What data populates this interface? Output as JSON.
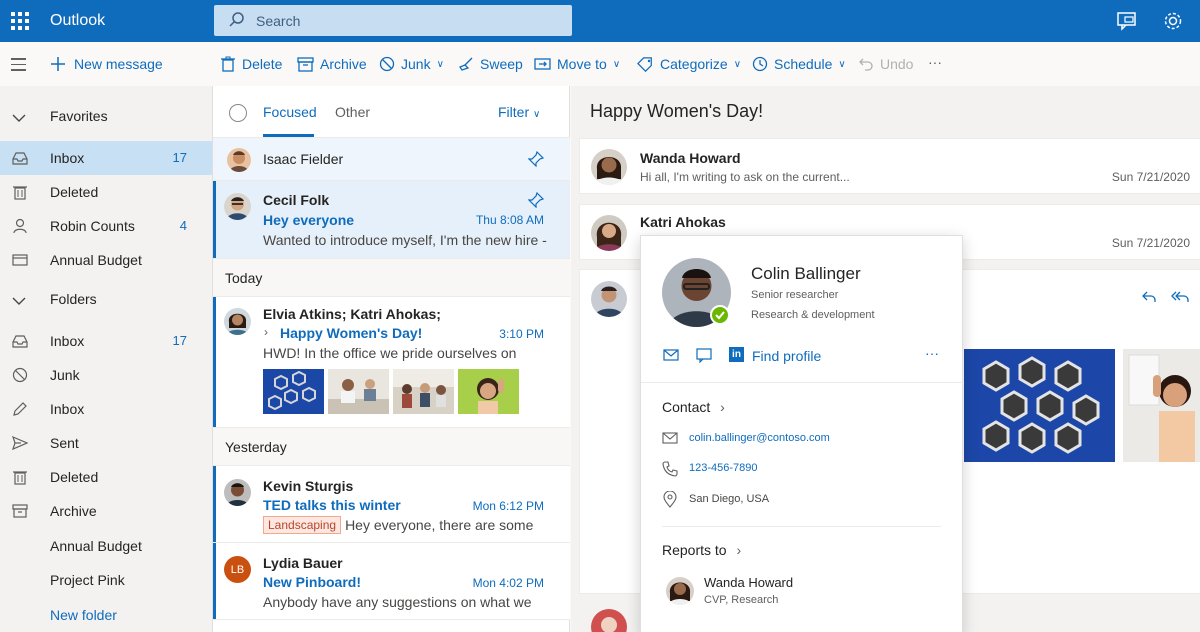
{
  "app": {
    "name": "Outlook"
  },
  "search": {
    "placeholder": "Search"
  },
  "toolbar": {
    "new_message": "New message",
    "delete": "Delete",
    "archive": "Archive",
    "junk": "Junk",
    "sweep": "Sweep",
    "move_to": "Move to",
    "categorize": "Categorize",
    "schedule": "Schedule",
    "undo": "Undo",
    "more": "···"
  },
  "nav": {
    "favorites": "Favorites",
    "folders_head": "Folders",
    "items": [
      {
        "label": "Inbox",
        "count": "17",
        "icon": "inbox-icon"
      },
      {
        "label": "Deleted",
        "count": "",
        "icon": "trash-icon"
      },
      {
        "label": "Robin Counts",
        "count": "4",
        "icon": "person-icon"
      },
      {
        "label": "Annual Budget",
        "count": "",
        "icon": "folder-icon"
      }
    ],
    "folders": [
      {
        "label": "Inbox",
        "count": "17",
        "icon": "inbox-icon"
      },
      {
        "label": "Junk",
        "count": "",
        "icon": "junk-icon"
      },
      {
        "label": "Inbox",
        "count": "",
        "icon": "pencil-icon"
      },
      {
        "label": "Sent",
        "count": "",
        "icon": "send-icon"
      },
      {
        "label": "Deleted",
        "count": "",
        "icon": "trash-icon"
      },
      {
        "label": "Archive",
        "count": "",
        "icon": "archive-icon"
      },
      {
        "label": "Annual Budget",
        "count": ""
      },
      {
        "label": "Project Pink",
        "count": ""
      }
    ],
    "new_folder": "New folder"
  },
  "list": {
    "tabs": {
      "focused": "Focused",
      "other": "Other",
      "filter": "Filter"
    },
    "pinned": [
      {
        "sender": "Isaac Fielder"
      },
      {
        "sender": "Cecil Folk",
        "subject": "Hey everyone",
        "time": "Thu 8:08 AM",
        "preview": "Wanted to introduce myself, I'm the new hire -"
      }
    ],
    "today_label": "Today",
    "today": [
      {
        "sender": "Elvia Atkins; Katri Ahokas;",
        "subject": "Happy Women's Day!",
        "time": "3:10 PM",
        "preview": "HWD! In the office we pride ourselves on"
      }
    ],
    "yesterday_label": "Yesterday",
    "yesterday": [
      {
        "sender": "Kevin Sturgis",
        "subject": "TED talks this winter",
        "time": "Mon 6:12 PM",
        "tag": "Landscaping",
        "preview": "Hey everyone, there are some"
      },
      {
        "sender": "Lydia Bauer",
        "initials": "LB",
        "subject": "New Pinboard!",
        "time": "Mon 4:02 PM",
        "preview": "Anybody have any suggestions on what we"
      }
    ]
  },
  "reading": {
    "title": "Happy Women's Day!",
    "messages": [
      {
        "sender": "Wanda Howard",
        "snippet": "Hi all, I'm writing to ask on the current...",
        "date": "Sun 7/21/2020"
      },
      {
        "sender": "Katri Ahokas",
        "snippet": "",
        "date": "Sun 7/21/2020"
      }
    ]
  },
  "contact_card": {
    "name": "Colin Ballinger",
    "title": "Senior researcher",
    "department": "Research & development",
    "find_profile": "Find profile",
    "more": "···",
    "contact_label": "Contact",
    "email": "colin.ballinger@contoso.com",
    "phone": "123-456-7890",
    "location": "San Diego, USA",
    "reports_label": "Reports to",
    "manager_name": "Wanda Howard",
    "manager_title": "CVP, Research"
  },
  "colors": {
    "accent": "#0f6cbd",
    "presence": "#6bb700"
  }
}
